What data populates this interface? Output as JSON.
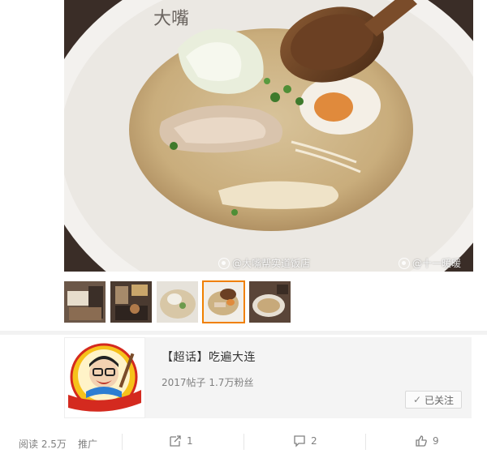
{
  "photo": {
    "watermark_left": "@大嘴帮实道饭店",
    "watermark_right": "@十一暖暖"
  },
  "thumbnails": {
    "count": 5,
    "active_index": 3
  },
  "topic": {
    "title": "【超话】吃遍大连",
    "stats": "2017帖子 1.7万粉丝",
    "follow_label": "已关注",
    "logo_text": "大嘴帮实道饭店"
  },
  "actions": {
    "reads": "阅读 2.5万",
    "promote": "推广",
    "repost_count": "1",
    "comment_count": "2",
    "like_count": "9"
  },
  "colors": {
    "active_thumb_border": "#f08000",
    "card_bg": "#f4f4f4",
    "muted_text": "#808080"
  }
}
